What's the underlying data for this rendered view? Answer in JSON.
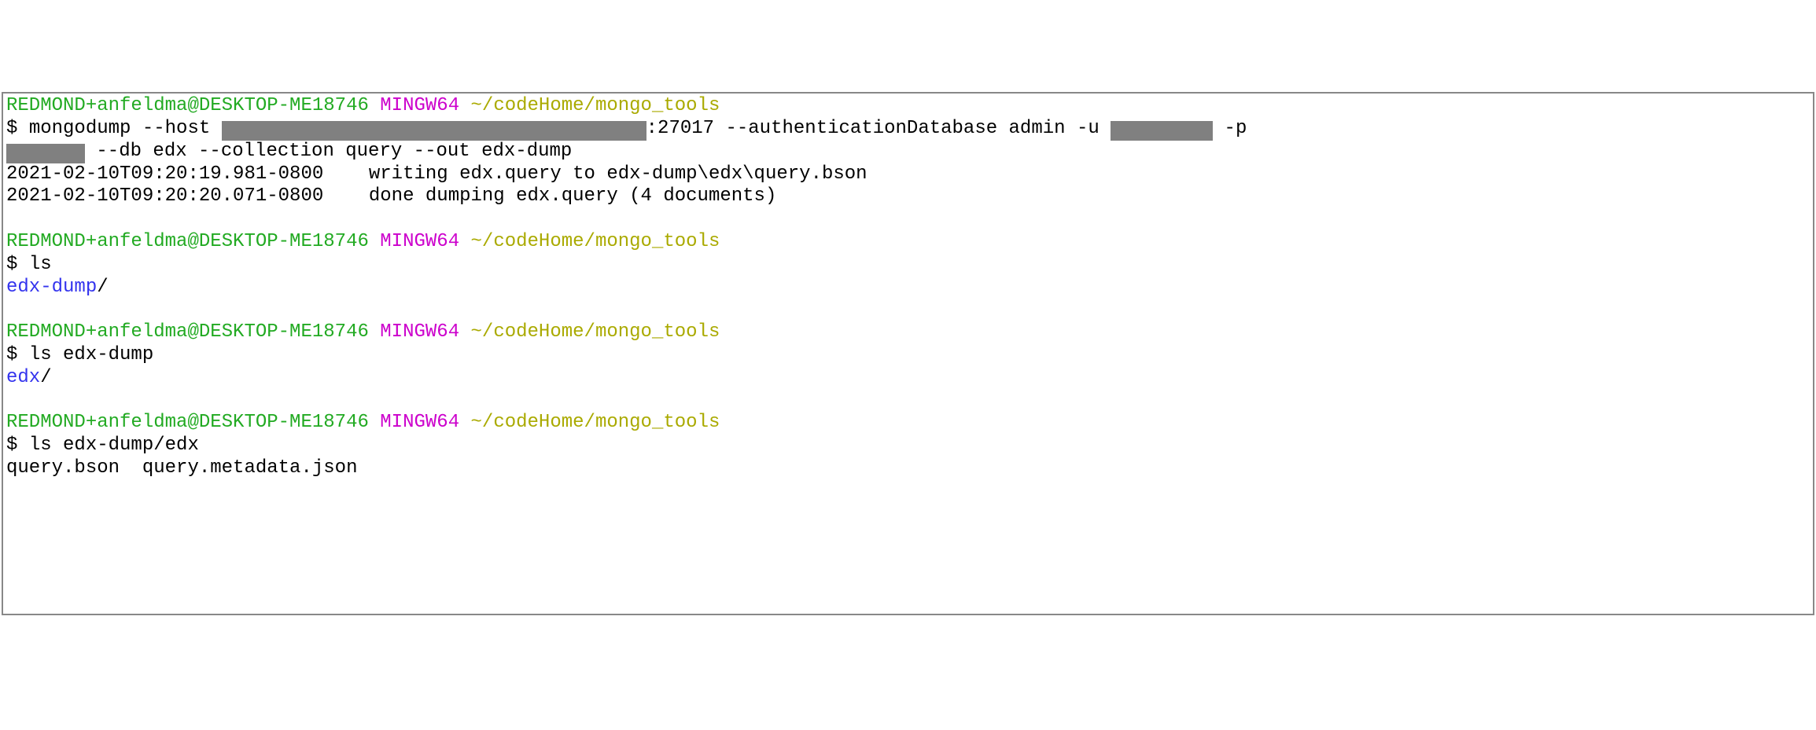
{
  "blocks": [
    {
      "prompt": {
        "user_host": "REDMOND+anfeldma@DESKTOP-ME18746",
        "mingw": "MINGW64",
        "path": "~/codeHome/mongo_tools"
      },
      "command_segments": [
        {
          "t": "prompt",
          "v": "$ "
        },
        {
          "t": "text",
          "v": "mongodump --host "
        },
        {
          "t": "redact",
          "cls": "w1"
        },
        {
          "t": "text",
          "v": ":27017 --authenticationDatabase admin -u "
        },
        {
          "t": "redact",
          "cls": "w2"
        },
        {
          "t": "text",
          "v": " -p"
        },
        {
          "t": "br"
        },
        {
          "t": "redact",
          "cls": "w3"
        },
        {
          "t": "text",
          "v": " --db edx --collection query --out edx-dump"
        }
      ],
      "output_lines": [
        {
          "segments": [
            {
              "t": "text",
              "v": "2021-02-10T09:20:19.981-0800    writing edx.query to edx-dump\\edx\\query.bson"
            }
          ]
        },
        {
          "segments": [
            {
              "t": "text",
              "v": "2021-02-10T09:20:20.071-0800    done dumping edx.query (4 documents)"
            }
          ]
        }
      ]
    },
    {
      "prompt": {
        "user_host": "REDMOND+anfeldma@DESKTOP-ME18746",
        "mingw": "MINGW64",
        "path": "~/codeHome/mongo_tools"
      },
      "command_segments": [
        {
          "t": "prompt",
          "v": "$ "
        },
        {
          "t": "text",
          "v": "ls"
        }
      ],
      "output_lines": [
        {
          "segments": [
            {
              "t": "dir",
              "v": "edx-dump"
            },
            {
              "t": "text",
              "v": "/"
            }
          ]
        }
      ]
    },
    {
      "prompt": {
        "user_host": "REDMOND+anfeldma@DESKTOP-ME18746",
        "mingw": "MINGW64",
        "path": "~/codeHome/mongo_tools"
      },
      "command_segments": [
        {
          "t": "prompt",
          "v": "$ "
        },
        {
          "t": "text",
          "v": "ls edx-dump"
        }
      ],
      "output_lines": [
        {
          "segments": [
            {
              "t": "dir",
              "v": "edx"
            },
            {
              "t": "text",
              "v": "/"
            }
          ]
        }
      ]
    },
    {
      "prompt": {
        "user_host": "REDMOND+anfeldma@DESKTOP-ME18746",
        "mingw": "MINGW64",
        "path": "~/codeHome/mongo_tools"
      },
      "command_segments": [
        {
          "t": "prompt",
          "v": "$ "
        },
        {
          "t": "text",
          "v": "ls edx-dump/edx"
        }
      ],
      "output_lines": [
        {
          "segments": [
            {
              "t": "text",
              "v": "query.bson  query.metadata.json"
            }
          ]
        }
      ]
    }
  ]
}
